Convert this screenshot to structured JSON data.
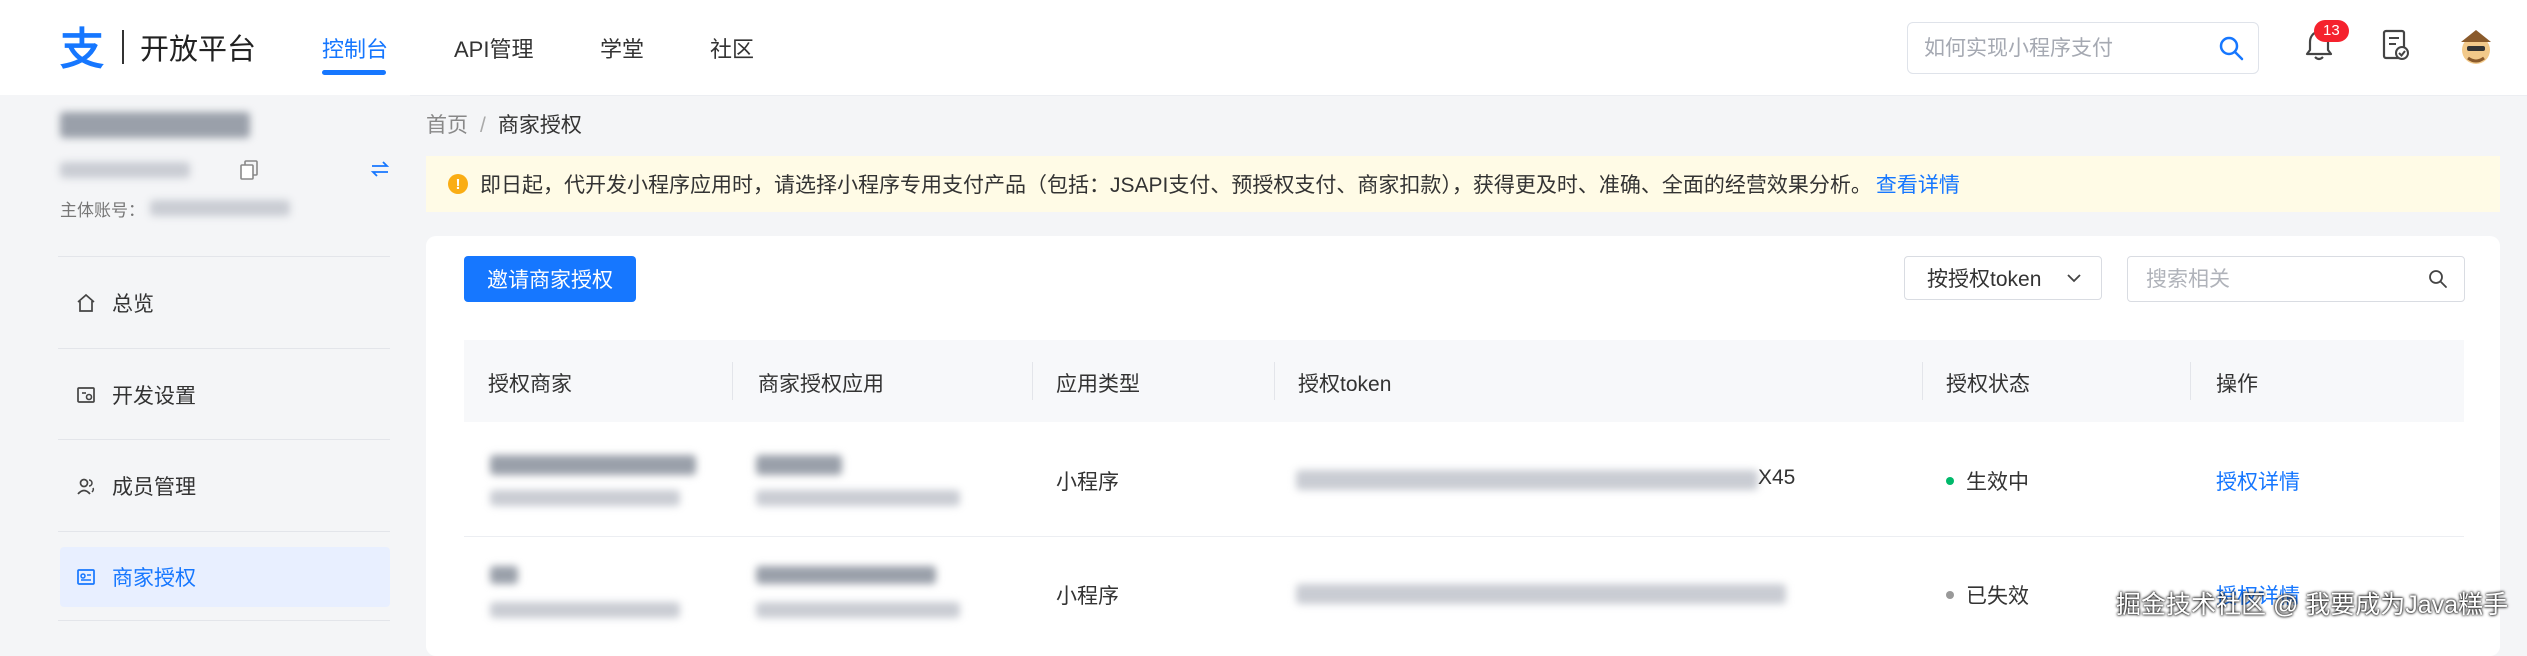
{
  "brand": {
    "logo_glyph": "支",
    "name": "开放平台",
    "color": "#1677ff"
  },
  "nav": {
    "items": [
      {
        "label": "控制台",
        "active": true
      },
      {
        "label": "API管理",
        "active": false
      },
      {
        "label": "学堂",
        "active": false
      },
      {
        "label": "社区",
        "active": false
      }
    ]
  },
  "header": {
    "search_placeholder": "如何实现小程序支付",
    "notification_count": "13"
  },
  "sidebar": {
    "account_label": "主体账号：",
    "items": [
      {
        "label": "总览",
        "icon": "home-icon",
        "active": false
      },
      {
        "label": "开发设置",
        "icon": "settings-panel-icon",
        "active": false
      },
      {
        "label": "成员管理",
        "icon": "members-icon",
        "active": false
      },
      {
        "label": "商家授权",
        "icon": "merchant-auth-icon",
        "active": true
      }
    ]
  },
  "breadcrumb": {
    "home": "首页",
    "separator": "/",
    "current": "商家授权"
  },
  "notice": {
    "text": "即日起，代开发小程序应用时，请选择小程序专用支付产品（包括：JSAPI支付、预授权支付、商家扣款），获得更及时、准确、全面的经营效果分析。",
    "link": "查看详情"
  },
  "toolbar": {
    "invite_button": "邀请商家授权",
    "filter_select": "按授权token",
    "search_placeholder": "搜索相关"
  },
  "table": {
    "columns": [
      "授权商家",
      "商家授权应用",
      "应用类型",
      "授权token",
      "授权状态",
      "操作"
    ],
    "rows": [
      {
        "app_type": "小程序",
        "token_suffix": "X45",
        "status": "生效中",
        "status_color": "#00b96b",
        "action": "授权详情"
      },
      {
        "app_type": "小程序",
        "token_suffix": "",
        "status": "已失效",
        "status_color": "#999999",
        "action": "授权详情"
      }
    ]
  },
  "watermark": "掘金技术社区 @ 我要成为Java糕手"
}
